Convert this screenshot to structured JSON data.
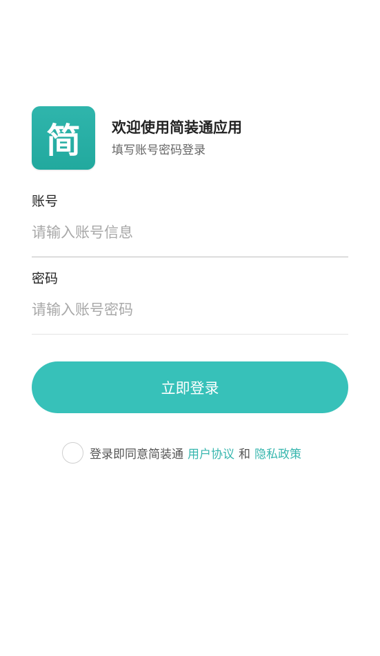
{
  "header": {
    "logo_char": "简",
    "title": "欢迎使用简装通应用",
    "subtitle": "填写账号密码登录"
  },
  "form": {
    "account": {
      "label": "账号",
      "placeholder": "请输入账号信息",
      "value": ""
    },
    "password": {
      "label": "密码",
      "placeholder": "请输入账号密码",
      "value": ""
    }
  },
  "login_button": {
    "label": "立即登录"
  },
  "agreement": {
    "checked": false,
    "prefix": "登录即同意简装通",
    "user_agreement": "用户协议",
    "conjunction": "和",
    "privacy_policy": "隐私政策"
  },
  "colors": {
    "accent": "#37c1b9",
    "logo": "#2aafa5",
    "link": "#37b6ae",
    "divider_account": "#bdbdbd",
    "divider_password": "#e3e3e3"
  }
}
